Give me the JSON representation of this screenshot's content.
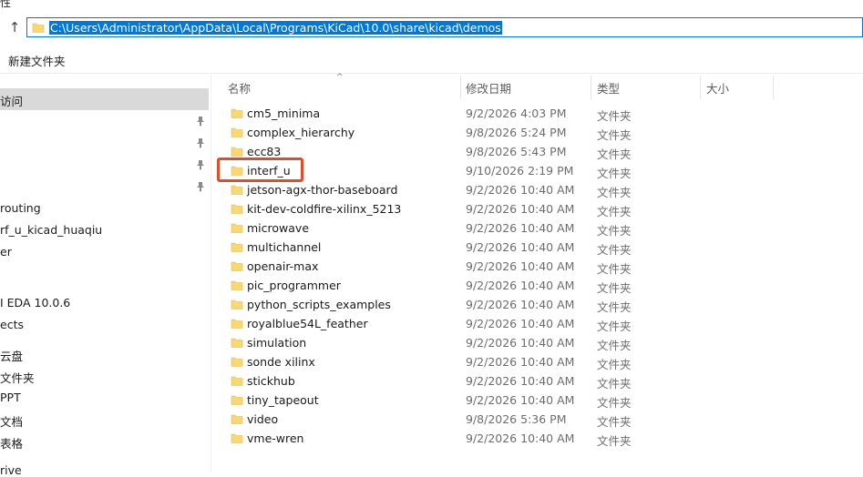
{
  "window": {
    "top_fragment": "性"
  },
  "address": {
    "path": "C:\\Users\\Administrator\\AppData\\Local\\Programs\\KiCad\\10.0\\share\\kicad\\demos"
  },
  "toolbar": {
    "new_folder_label": "新建文件夹"
  },
  "nav": {
    "items": [
      "访问",
      "routing",
      "rf_u_kicad_huaqiu",
      "er",
      "I EDA 10.0.6",
      "ects",
      "云盘",
      "文件夹",
      "PPT",
      "文档",
      "表格",
      "rive"
    ]
  },
  "columns": {
    "name": "名称",
    "modified": "修改日期",
    "type": "类型",
    "size": "大小"
  },
  "files": [
    {
      "name": "cm5_minima",
      "modified": "9/2/2026 4:03 PM",
      "type": "文件夹"
    },
    {
      "name": "complex_hierarchy",
      "modified": "9/8/2026 5:24 PM",
      "type": "文件夹"
    },
    {
      "name": "ecc83",
      "modified": "9/8/2026 5:43 PM",
      "type": "文件夹"
    },
    {
      "name": "interf_u",
      "modified": "9/10/2026 2:19 PM",
      "type": "文件夹"
    },
    {
      "name": "jetson-agx-thor-baseboard",
      "modified": "9/2/2026 10:40 AM",
      "type": "文件夹"
    },
    {
      "name": "kit-dev-coldfire-xilinx_5213",
      "modified": "9/2/2026 10:40 AM",
      "type": "文件夹"
    },
    {
      "name": "microwave",
      "modified": "9/2/2026 10:40 AM",
      "type": "文件夹"
    },
    {
      "name": "multichannel",
      "modified": "9/2/2026 10:40 AM",
      "type": "文件夹"
    },
    {
      "name": "openair-max",
      "modified": "9/2/2026 10:40 AM",
      "type": "文件夹"
    },
    {
      "name": "pic_programmer",
      "modified": "9/2/2026 10:40 AM",
      "type": "文件夹"
    },
    {
      "name": "python_scripts_examples",
      "modified": "9/2/2026 10:40 AM",
      "type": "文件夹"
    },
    {
      "name": "royalblue54L_feather",
      "modified": "9/2/2026 10:40 AM",
      "type": "文件夹"
    },
    {
      "name": "simulation",
      "modified": "9/2/2026 10:40 AM",
      "type": "文件夹"
    },
    {
      "name": "sonde xilinx",
      "modified": "9/2/2026 10:40 AM",
      "type": "文件夹"
    },
    {
      "name": "stickhub",
      "modified": "9/2/2026 10:40 AM",
      "type": "文件夹"
    },
    {
      "name": "tiny_tapeout",
      "modified": "9/2/2026 10:40 AM",
      "type": "文件夹"
    },
    {
      "name": "video",
      "modified": "9/8/2026 5:36 PM",
      "type": "文件夹"
    },
    {
      "name": "vme-wren",
      "modified": "9/2/2026 10:40 AM",
      "type": "文件夹"
    }
  ],
  "colors": {
    "accent": "#0078d7",
    "highlight": "#d9502f",
    "folder": "#f8d775"
  },
  "icons": {
    "folder": "folder-icon",
    "pin": "pin-icon",
    "up": "up-arrow-icon"
  }
}
